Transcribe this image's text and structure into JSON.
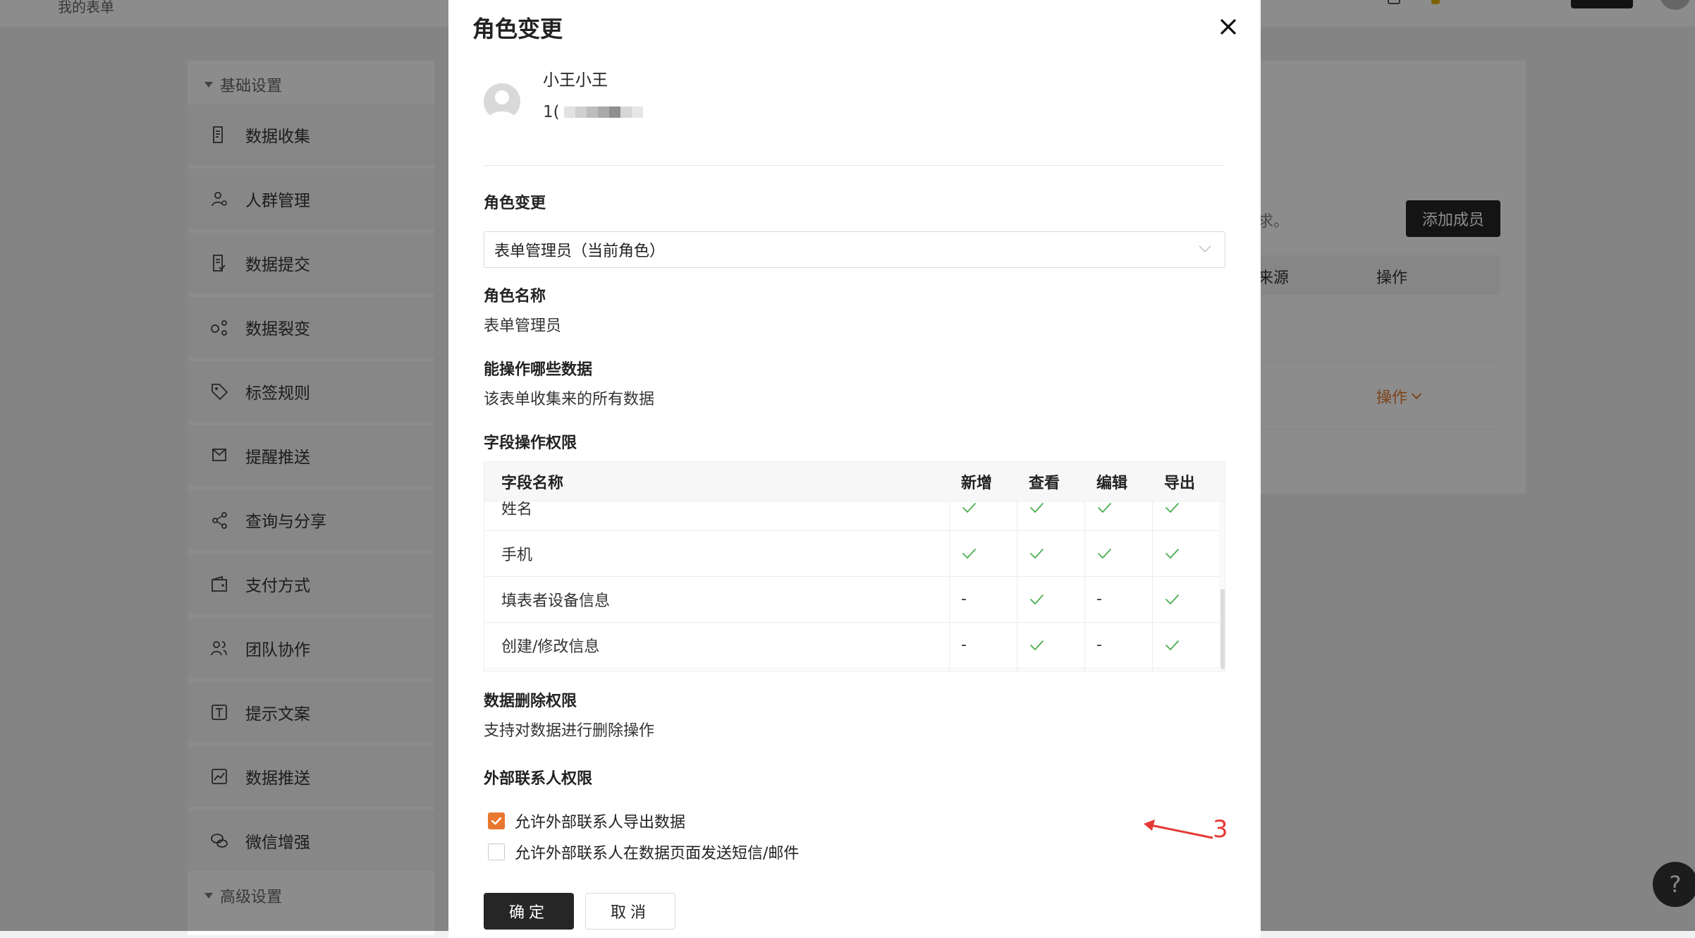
{
  "background": {
    "breadcrumb": "我的表单",
    "sidebar": {
      "group_basic": "基础设置",
      "group_advanced": "高级设置",
      "items": [
        {
          "label": "数据收集",
          "icon": "document-icon"
        },
        {
          "label": "人群管理",
          "icon": "user-settings-icon"
        },
        {
          "label": "数据提交",
          "icon": "submit-document-icon"
        },
        {
          "label": "数据裂变",
          "icon": "share-nodes-icon"
        },
        {
          "label": "标签规则",
          "icon": "tag-icon"
        },
        {
          "label": "提醒推送",
          "icon": "reminder-icon"
        },
        {
          "label": "查询与分享",
          "icon": "share-icon"
        },
        {
          "label": "支付方式",
          "icon": "wallet-icon"
        },
        {
          "label": "团队协作",
          "icon": "team-icon"
        },
        {
          "label": "提示文案",
          "icon": "text-box-icon"
        },
        {
          "label": "数据推送",
          "icon": "chart-icon"
        },
        {
          "label": "微信增强",
          "icon": "wechat-icon"
        }
      ]
    },
    "content": {
      "hint_tail": "求。",
      "add_member": "添加成员",
      "col_source_tail": "来源",
      "col_action": "操作",
      "row_action": "操作"
    },
    "help": "?"
  },
  "modal": {
    "title": "角色变更",
    "user": {
      "name": "小王小王",
      "phone_prefix": "1("
    },
    "role_change": {
      "label": "角色变更",
      "selected": "表单管理员（当前角色）"
    },
    "role_name": {
      "label": "角色名称",
      "value": "表单管理员"
    },
    "data_scope": {
      "label": "能操作哪些数据",
      "value": "该表单收集来的所有数据"
    },
    "field_perm": {
      "label": "字段操作权限",
      "headers": [
        "字段名称",
        "新增",
        "查看",
        "编辑",
        "导出"
      ],
      "rows": [
        {
          "name": "姓名",
          "add": true,
          "view": true,
          "edit": true,
          "export": true
        },
        {
          "name": "手机",
          "add": true,
          "view": true,
          "edit": true,
          "export": true
        },
        {
          "name": "填表者设备信息",
          "add": false,
          "view": true,
          "edit": false,
          "export": true
        },
        {
          "name": "创建/修改信息",
          "add": false,
          "view": true,
          "edit": false,
          "export": true
        }
      ],
      "dash": "-"
    },
    "delete_perm": {
      "label": "数据删除权限",
      "value": "支持对数据进行删除操作"
    },
    "external_perm": {
      "label": "外部联系人权限",
      "options": [
        {
          "label": "允许外部联系人导出数据",
          "checked": true
        },
        {
          "label": "允许外部联系人在数据页面发送短信/邮件",
          "checked": false
        }
      ]
    },
    "annotation_number": "3",
    "ok": "确定",
    "cancel": "取消"
  },
  "colors": {
    "accent": "#e8782f",
    "check": "#4caf50",
    "dark_button": "#262626",
    "annotation": "#e53935"
  }
}
